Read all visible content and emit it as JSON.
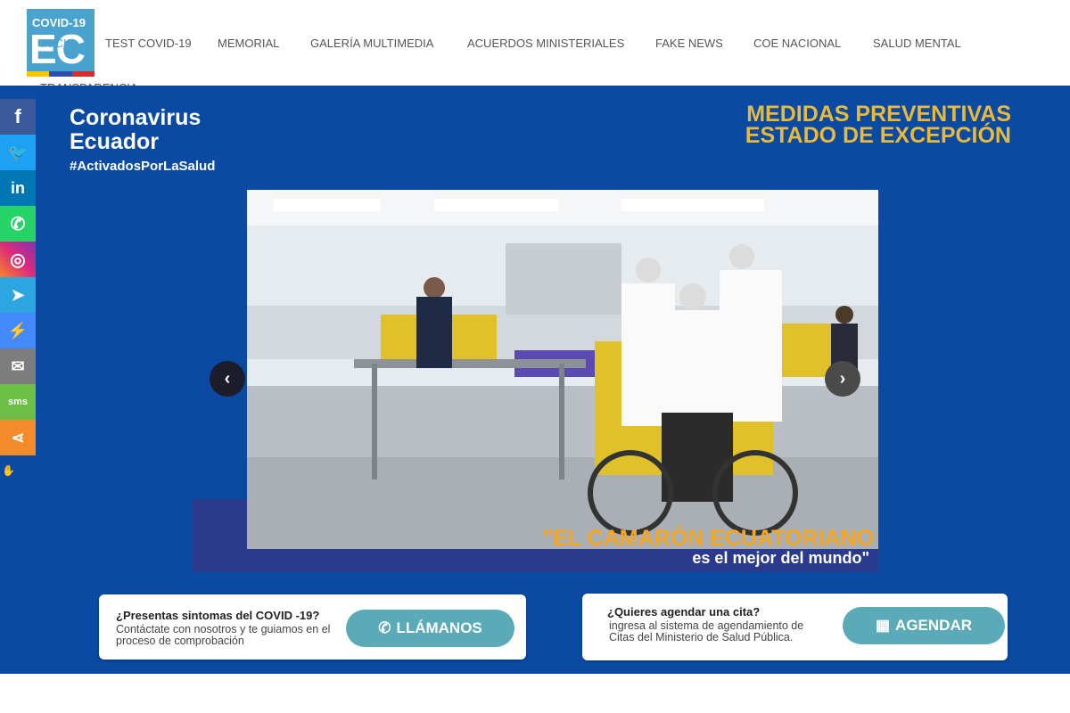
{
  "logo": {
    "top": "COVID-19",
    "main": "EC",
    "stripe_colors": [
      "#f7c600",
      "#2b4fb1",
      "#d32f2f"
    ]
  },
  "nav": {
    "items": [
      "INICIO",
      "TEST COVID-19",
      "MEMORIAL",
      "GALERÍA MULTIMEDIA",
      "ACUERDOS MINISTERIALES",
      "FAKE NEWS",
      "COE NACIONAL",
      "SALUD MENTAL",
      "TRANSPARENCIA"
    ]
  },
  "hero": {
    "brand_line1": "Coronavirus",
    "brand_line2": "Ecuador",
    "brand_tag": "#ActivadosPorLaSalud",
    "medidas": "MEDIDAS PREVENTIVAS ESTADO DE EXCEPCIÓN",
    "caption_line1": "\"EL CAMARÓN ECUATORIANO",
    "caption_line2": "es el mejor del mundo\"",
    "prev_icon": "chevron-left-icon",
    "next_icon": "chevron-right-icon",
    "background": "#0a4aa3"
  },
  "social": {
    "buttons": [
      {
        "name": "facebook",
        "icon": "facebook-icon",
        "glyph": "f",
        "color": "#3b5998"
      },
      {
        "name": "twitter",
        "icon": "twitter-icon",
        "glyph": "🐦",
        "color": "#1da1f2"
      },
      {
        "name": "linkedin",
        "icon": "linkedin-icon",
        "glyph": "in",
        "color": "#0077b5"
      },
      {
        "name": "whatsapp",
        "icon": "whatsapp-icon",
        "glyph": "✆",
        "color": "#25d366"
      },
      {
        "name": "instagram",
        "icon": "instagram-icon",
        "glyph": "◎",
        "color": "#c13584"
      },
      {
        "name": "telegram",
        "icon": "telegram-icon",
        "glyph": "➤",
        "color": "#2ca5e0"
      },
      {
        "name": "messenger",
        "icon": "messenger-icon",
        "glyph": "⚡",
        "color": "#448aff"
      },
      {
        "name": "email",
        "icon": "email-icon",
        "glyph": "✉",
        "color": "#7d7d7d"
      },
      {
        "name": "sms",
        "icon": "sms-icon",
        "glyph": "sms",
        "color": "#6cbe45"
      },
      {
        "name": "share",
        "icon": "share-icon",
        "glyph": "⋖",
        "color": "#f38b2b"
      }
    ],
    "hide_icon": "hand-icon"
  },
  "cards": {
    "card1": {
      "title": "¿Presentas sintomas del COVID -19?",
      "text": "Contáctate con nosotros y te guiamos en el proceso de comprobación",
      "button": "LLÁMANOS",
      "button_icon": "phone-icon"
    },
    "card2": {
      "title": "¿Quieres agendar una cita?",
      "text": "ingresa al sistema de agendamiento de Citas del Ministerio de Salud Pública.",
      "button": "AGENDAR",
      "button_icon": "calendar-icon"
    },
    "button_color": "#5aaab8"
  }
}
